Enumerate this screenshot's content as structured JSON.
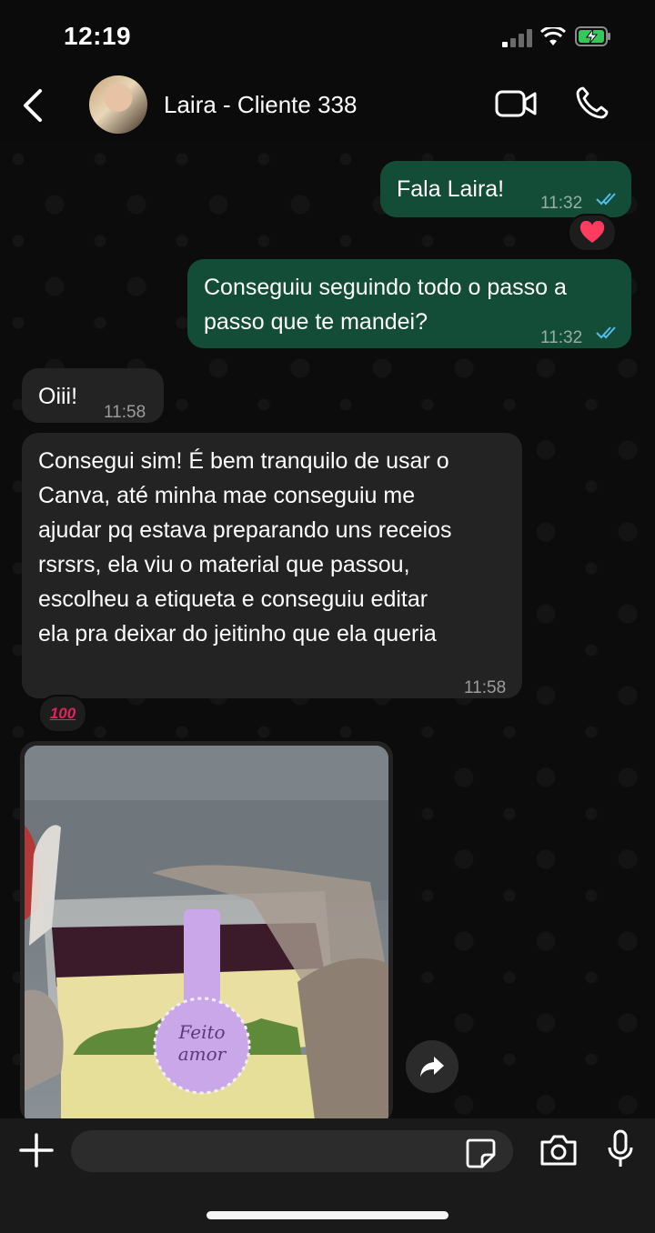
{
  "status_bar": {
    "time": "12:19"
  },
  "header": {
    "contact_name": "Laira - Cliente 338"
  },
  "messages": [
    {
      "direction": "out",
      "text": "Fala Laira!",
      "time": "11:32",
      "read": true,
      "reaction": "heart"
    },
    {
      "direction": "out",
      "lines": [
        "Conseguiu seguindo todo o passo a",
        "passo que te mandei?"
      ],
      "time": "11:32",
      "read": true
    },
    {
      "direction": "in",
      "text": "Oiii!",
      "time": "11:58"
    },
    {
      "direction": "in",
      "lines": [
        "Consegui sim! É bem tranquilo de usar o",
        "Canva, até minha mae conseguiu me",
        "ajudar pq estava preparando uns receios",
        "rsrsrs, ela viu o material que passou,",
        "escolheu a etiqueta e conseguiu editar",
        "ela pra deixar do jeitinho que ela queria"
      ],
      "time": "11:58",
      "reaction": "hundred"
    },
    {
      "direction": "in",
      "type": "image",
      "label_text": [
        "Feito",
        "amor"
      ]
    }
  ],
  "reactions": {
    "hundred_label": "100"
  },
  "composer": {
    "placeholder": ""
  },
  "colors": {
    "outgoing": "#144d37",
    "incoming": "#232323",
    "read_ticks": "#53bdeb"
  }
}
